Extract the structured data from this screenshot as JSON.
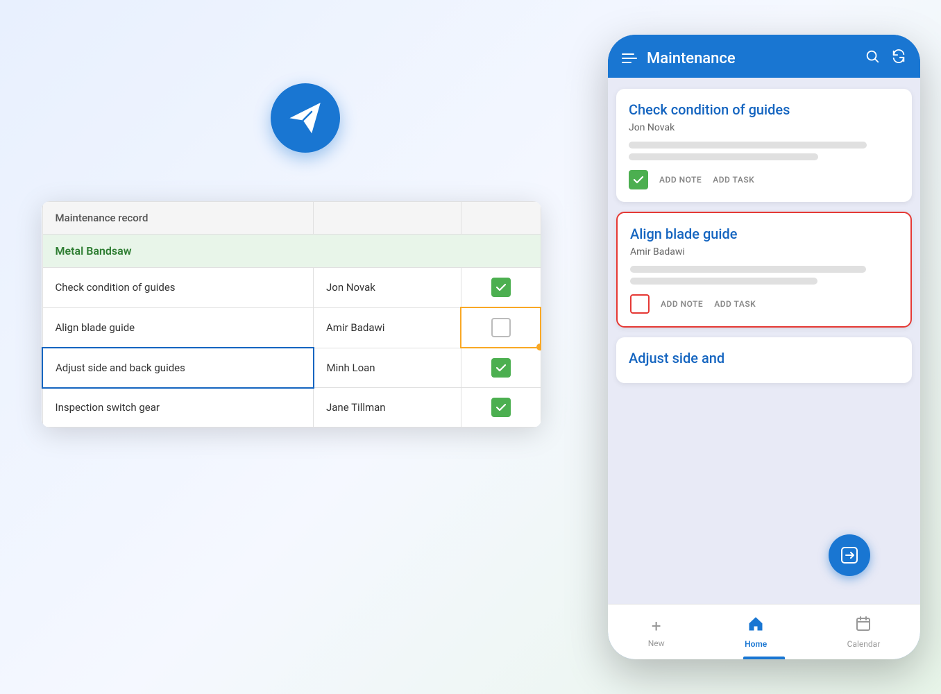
{
  "background": {
    "color": "#f0f4f8"
  },
  "floatingIcon": {
    "ariaLabel": "Send / Paper plane icon"
  },
  "spreadsheet": {
    "headerRow": {
      "col1": "Maintenance record",
      "col2": "",
      "col3": ""
    },
    "sectionLabel": "Metal Bandsaw",
    "rows": [
      {
        "task": "Check condition of guides",
        "assignee": "Jon Novak",
        "status": "checked",
        "highlighted": false,
        "cellSelected": false
      },
      {
        "task": "Align blade guide",
        "assignee": "Amir Badawi",
        "status": "unchecked",
        "highlighted": false,
        "cellSelected": true
      },
      {
        "task": "Adjust side and back guides",
        "assignee": "Minh Loan",
        "status": "checked",
        "highlighted": true,
        "cellSelected": false
      },
      {
        "task": "Inspection switch gear",
        "assignee": "Jane Tillman",
        "status": "checked",
        "highlighted": false,
        "cellSelected": false
      }
    ]
  },
  "phone": {
    "header": {
      "title": "Maintenance",
      "menuIcon": "≡",
      "searchIcon": "🔍",
      "refreshIcon": "↻"
    },
    "cards": [
      {
        "title": "Check condition of guides",
        "subtitle": "Jon Novak",
        "checkState": "green",
        "actions": [
          "ADD NOTE",
          "ADD TASK"
        ],
        "selected": false
      },
      {
        "title": "Align blade guide",
        "subtitle": "Amir Badawi",
        "checkState": "red",
        "actions": [
          "ADD NOTE",
          "ADD TASK"
        ],
        "selected": true
      }
    ],
    "partialCard": {
      "title": "Adjust side and"
    },
    "fab": {
      "icon": "→"
    },
    "bottomNav": [
      {
        "label": "New",
        "icon": "+",
        "active": false
      },
      {
        "label": "Home",
        "icon": "⌂",
        "active": true
      },
      {
        "label": "Calendar",
        "icon": "📅",
        "active": false
      }
    ]
  }
}
